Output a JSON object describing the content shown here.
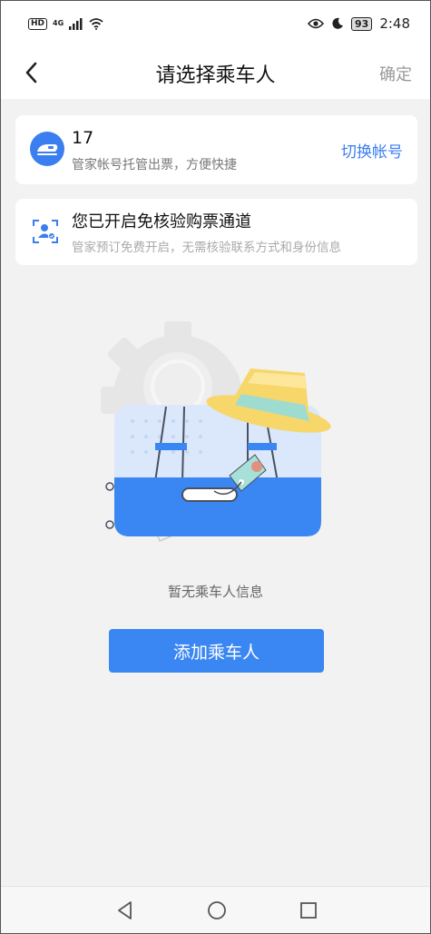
{
  "status_bar": {
    "hd": "HD",
    "network": "4G",
    "battery": "93",
    "time": "2:48"
  },
  "nav": {
    "title": "请选择乘车人",
    "confirm_label": "确定"
  },
  "account_card": {
    "number": "17",
    "description": "管家帐号托管出票，方便快捷",
    "switch_label": "切换帐号"
  },
  "channel_card": {
    "title": "您已开启免核验购票通道",
    "description": "管家预订免费开启，无需核验联系方式和身份信息"
  },
  "empty_state": {
    "message": "暂无乘车人信息",
    "add_button_label": "添加乘车人"
  },
  "colors": {
    "accent": "#3a7ef0",
    "button": "#3a86f2",
    "background": "#f2f2f2"
  },
  "icons": {
    "back": "chevron-left-icon",
    "avatar": "train-icon",
    "channel": "face-scan-icon",
    "sys_back": "triangle-back-icon",
    "sys_home": "circle-home-icon",
    "sys_recent": "square-recent-icon"
  }
}
